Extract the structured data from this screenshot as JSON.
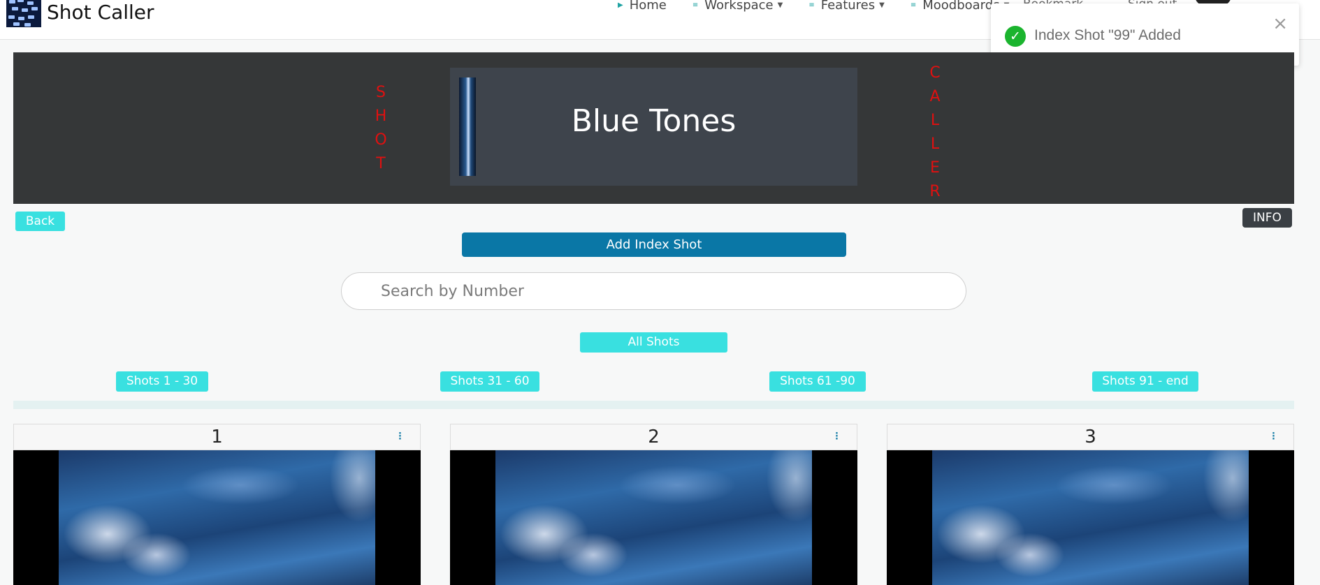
{
  "navbar": {
    "brand": "Shot Caller",
    "items": [
      {
        "label": "Home",
        "has_caret": false
      },
      {
        "label": "Workspace",
        "has_caret": true
      },
      {
        "label": "Features",
        "has_caret": true
      },
      {
        "label": "Moodboards",
        "has_caret": true
      }
    ],
    "faded_items": [
      "Bookmark",
      "Sign out"
    ]
  },
  "toast": {
    "message": "Index Shot \"99\" Added",
    "close": "×",
    "progress": 0.69
  },
  "hero": {
    "left_vertical": [
      "S",
      "H",
      "O",
      "T"
    ],
    "right_vertical": [
      "C",
      "A",
      "L",
      "L",
      "E",
      "R"
    ],
    "title": "Blue Tones"
  },
  "buttons": {
    "back": "Back",
    "info": "INFO",
    "add_index_shot": "Add Index Shot",
    "all_shots": "All Shots",
    "ranges": [
      "Shots 1 - 30",
      "Shots 31 - 60",
      "Shots 61 -90",
      "Shots 91 - end"
    ]
  },
  "search": {
    "placeholder": "Search by Number"
  },
  "shots": [
    {
      "number": "1"
    },
    {
      "number": "2"
    },
    {
      "number": "3"
    }
  ],
  "colors": {
    "accent": "#39e0e0",
    "primary": "#0a77a6",
    "hero_bg": "#353738",
    "hero_letters": "#e01010",
    "toast_success": "#1bb42e"
  },
  "icons": {
    "nav_home": "caret-right-icon",
    "nav_menu": "list-icon",
    "toast": "check-circle-icon",
    "card_menu": "kebab-menu-icon"
  }
}
